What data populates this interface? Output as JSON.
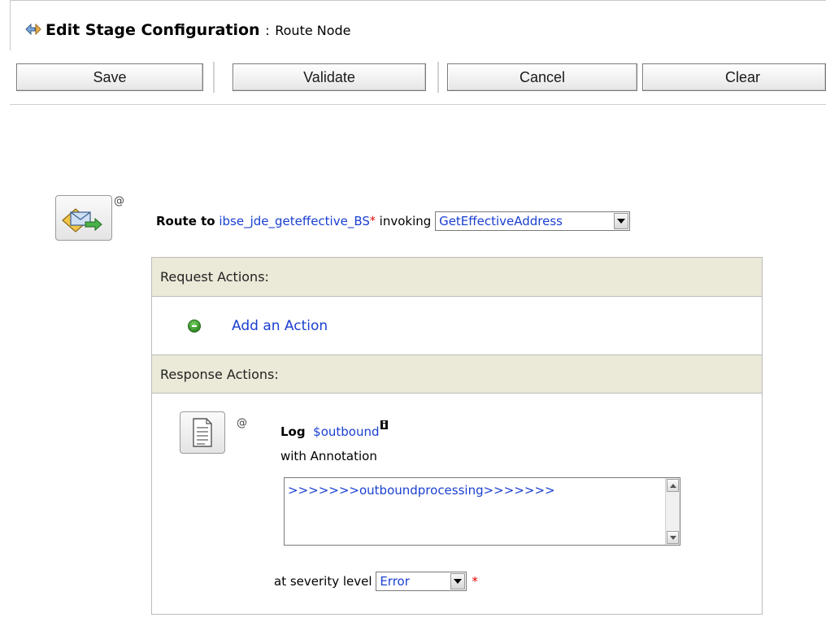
{
  "header": {
    "title": "Edit Stage Configuration",
    "separator": ":",
    "subtitle": "Route Node",
    "icon": "edit-stage-icon"
  },
  "toolbar": {
    "save_label": "Save",
    "validate_label": "Validate",
    "cancel_label": "Cancel",
    "clear_label": "Clear"
  },
  "route": {
    "icon": "route-envelope-icon",
    "at_symbol": "@",
    "keyword": "Route to",
    "service": "ibse_jde_geteffective_BS",
    "required_mark": "*",
    "invoking_label": "invoking",
    "operation": "GetEffectiveAddress"
  },
  "request_actions": {
    "header": "Request Actions:",
    "add_action": "Add an Action"
  },
  "response_actions": {
    "header": "Response Actions:",
    "log": {
      "icon": "log-document-icon",
      "at_symbol": "@",
      "keyword": "Log",
      "variable": "$outbound",
      "annotation_label": "with Annotation",
      "annotation_value": ">>>>>>>outboundprocessing>>>>>>>",
      "severity_label": "at severity level",
      "severity_value": "Error",
      "required_mark": "*"
    }
  }
}
